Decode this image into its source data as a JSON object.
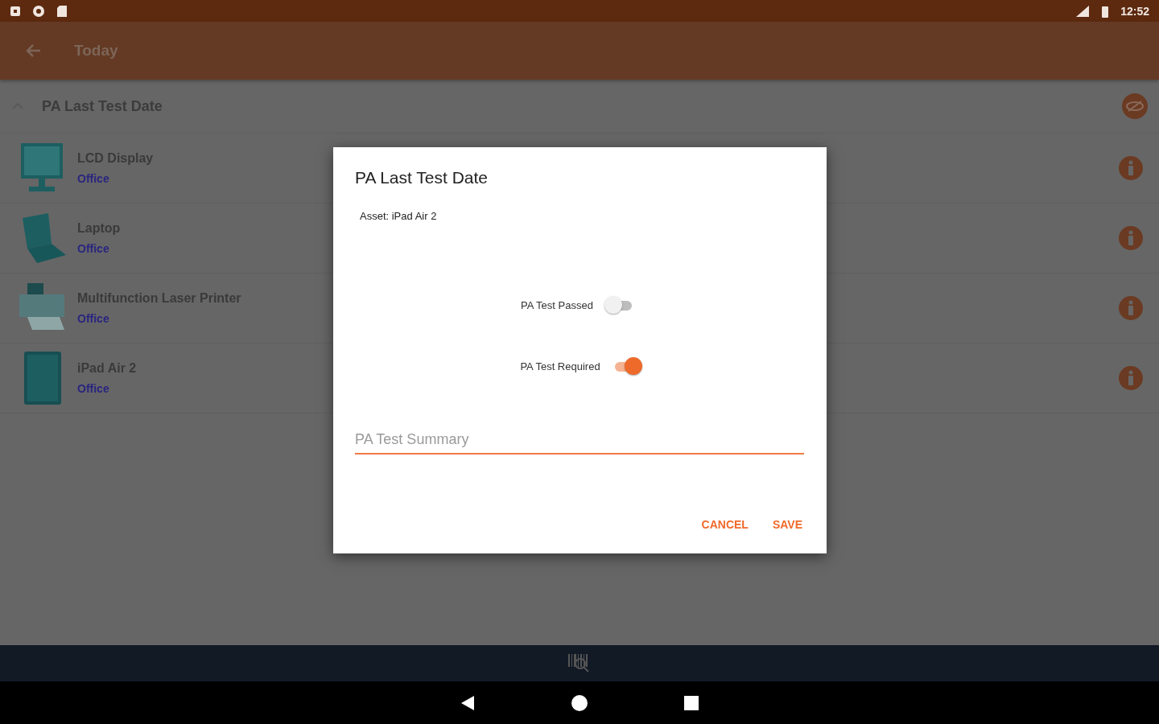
{
  "status_bar": {
    "time": "12:52"
  },
  "app_bar": {
    "title": "Today"
  },
  "section": {
    "title": "PA Last Test Date",
    "expanded": true
  },
  "assets": [
    {
      "kind": "monitor",
      "name": "LCD Display",
      "location": "Office"
    },
    {
      "kind": "laptop",
      "name": "Laptop",
      "location": "Office"
    },
    {
      "kind": "printer",
      "name": "Multifunction Laser Printer",
      "location": "Office"
    },
    {
      "kind": "tablet",
      "name": "iPad Air 2",
      "location": "Office"
    }
  ],
  "dialog": {
    "title": "PA Last Test Date",
    "asset": "Asset: iPad Air 2",
    "switches": [
      {
        "label": "PA Test Passed",
        "on": false
      },
      {
        "label": "PA Test Required",
        "on": true
      }
    ],
    "field": {
      "placeholder": "PA Test Summary"
    },
    "buttons": [
      "CANCEL",
      "SAVE"
    ]
  }
}
